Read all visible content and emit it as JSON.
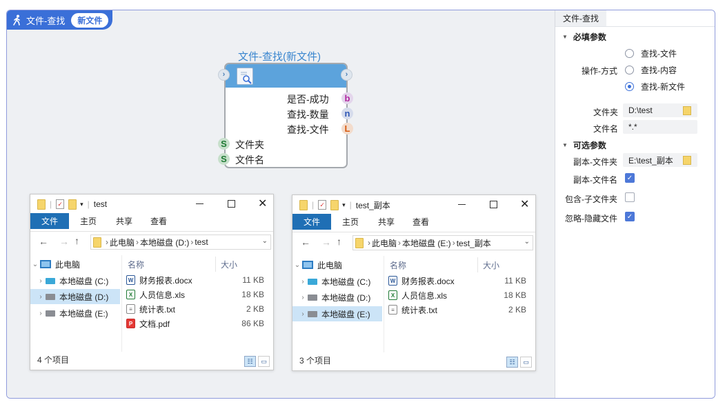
{
  "app": {
    "title": "文件-查找",
    "badge": "新文件"
  },
  "node": {
    "title": "文件-查找(新文件)",
    "outputs": [
      {
        "label": "是否-成功",
        "port": "b"
      },
      {
        "label": "查找-数量",
        "port": "n"
      },
      {
        "label": "查找-文件",
        "port": "L"
      }
    ],
    "inputs": [
      {
        "label": "文件夹",
        "port": "S"
      },
      {
        "label": "文件名",
        "port": "S"
      }
    ]
  },
  "explorers": [
    {
      "title": "test",
      "tabs": [
        "文件",
        "主页",
        "共享",
        "查看"
      ],
      "path": [
        "此电脑",
        "本地磁盘 (D:)",
        "test"
      ],
      "tree": [
        "此电脑",
        "本地磁盘 (C:)",
        "本地磁盘 (D:)",
        "本地磁盘 (E:)"
      ],
      "selected_tree": 2,
      "col_name": "名称",
      "col_size": "大小",
      "files": [
        {
          "name": "财务报表.docx",
          "size": "11 KB",
          "type": "W"
        },
        {
          "name": "人员信息.xls",
          "size": "18 KB",
          "type": "X"
        },
        {
          "name": "统计表.txt",
          "size": "2 KB",
          "type": "T"
        },
        {
          "name": "文档.pdf",
          "size": "86 KB",
          "type": "P"
        }
      ],
      "status": "4 个项目"
    },
    {
      "title": "test_副本",
      "tabs": [
        "文件",
        "主页",
        "共享",
        "查看"
      ],
      "path": [
        "此电脑",
        "本地磁盘 (E:)",
        "test_副本"
      ],
      "tree": [
        "此电脑",
        "本地磁盘 (C:)",
        "本地磁盘 (D:)",
        "本地磁盘 (E:)"
      ],
      "selected_tree": 3,
      "col_name": "名称",
      "col_size": "大小",
      "files": [
        {
          "name": "财务报表.docx",
          "size": "11 KB",
          "type": "W"
        },
        {
          "name": "人员信息.xls",
          "size": "18 KB",
          "type": "X"
        },
        {
          "name": "统计表.txt",
          "size": "2 KB",
          "type": "T"
        }
      ],
      "status": "3 个项目"
    }
  ],
  "panel": {
    "tab": "文件-查找",
    "required_title": "必填参数",
    "op_label": "操作-方式",
    "op_options": [
      "查找-文件",
      "查找-内容",
      "查找-新文件"
    ],
    "op_selected": 2,
    "folder_label": "文件夹",
    "folder_value": "D:\\test",
    "filename_label": "文件名",
    "filename_value": "*.*",
    "optional_title": "可选参数",
    "copy_folder_label": "副本-文件夹",
    "copy_folder_value": "E:\\test_副本",
    "copy_filename_label": "副本-文件名",
    "copy_filename_checked": true,
    "include_sub_label": "包含-子文件夹",
    "include_sub_checked": false,
    "ignore_hidden_label": "忽略-隐藏文件",
    "ignore_hidden_checked": true
  },
  "colors": {
    "accent": "#3a6fd8",
    "node_header": "#5ca3dc",
    "ribbon_active": "#1f6fb5"
  }
}
